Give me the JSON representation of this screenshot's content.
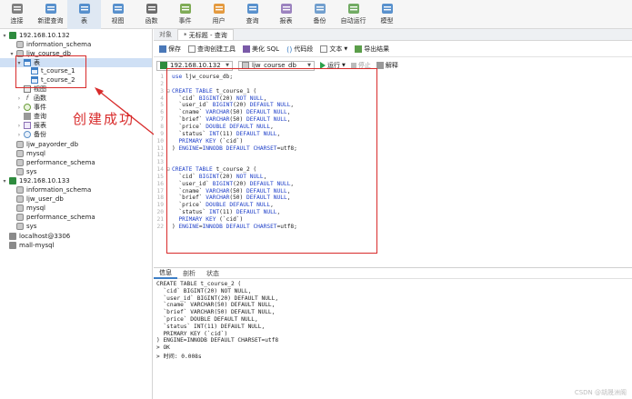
{
  "toolbar": {
    "items": [
      {
        "label": "连接",
        "icon": "connect-icon"
      },
      {
        "label": "新建查询",
        "icon": "new-query-icon"
      },
      {
        "label": "表",
        "icon": "table-icon"
      },
      {
        "label": "视图",
        "icon": "view-icon"
      },
      {
        "label": "函数",
        "icon": "function-icon"
      },
      {
        "label": "事件",
        "icon": "event-icon"
      },
      {
        "label": "用户",
        "icon": "user-icon"
      },
      {
        "label": "查询",
        "icon": "query-icon"
      },
      {
        "label": "报表",
        "icon": "report-icon"
      },
      {
        "label": "备份",
        "icon": "backup-icon"
      },
      {
        "label": "自动运行",
        "icon": "automation-icon"
      },
      {
        "label": "模型",
        "icon": "model-icon"
      }
    ],
    "active_index": 2
  },
  "sidebar": {
    "rows": [
      {
        "text": "192.168.10.132",
        "icon": "conn",
        "expander": "▾"
      },
      {
        "text": "information_schema",
        "icon": "db",
        "expander": ""
      },
      {
        "text": "ljw_course_db",
        "icon": "db",
        "expander": "▾"
      },
      {
        "text": "表",
        "icon": "table",
        "expander": "▾",
        "selected": true
      },
      {
        "text": "t_course_1",
        "icon": "table",
        "expander": ""
      },
      {
        "text": "t_course_2",
        "icon": "table",
        "expander": ""
      },
      {
        "text": "视图",
        "icon": "view",
        "expander": ""
      },
      {
        "text": "函数",
        "icon": "func",
        "expander": "›"
      },
      {
        "text": "事件",
        "icon": "event",
        "expander": "›"
      },
      {
        "text": "查询",
        "icon": "query",
        "expander": ""
      },
      {
        "text": "报表",
        "icon": "report",
        "expander": "›"
      },
      {
        "text": "备份",
        "icon": "backup",
        "expander": "›"
      },
      {
        "text": "ljw_payorder_db",
        "icon": "db",
        "expander": ""
      },
      {
        "text": "mysql",
        "icon": "db",
        "expander": ""
      },
      {
        "text": "performance_schema",
        "icon": "db",
        "expander": ""
      },
      {
        "text": "sys",
        "icon": "db",
        "expander": ""
      },
      {
        "text": "192.168.10.133",
        "icon": "conn",
        "expander": "▾"
      },
      {
        "text": "information_schema",
        "icon": "db",
        "expander": ""
      },
      {
        "text": "ljw_user_db",
        "icon": "db",
        "expander": ""
      },
      {
        "text": "mysql",
        "icon": "db",
        "expander": ""
      },
      {
        "text": "performance_schema",
        "icon": "db",
        "expander": ""
      },
      {
        "text": "sys",
        "icon": "db",
        "expander": ""
      },
      {
        "text": "localhost@3306",
        "icon": "conn-gray",
        "expander": ""
      },
      {
        "text": "mall-mysql",
        "icon": "conn-gray",
        "expander": ""
      }
    ]
  },
  "annotation": {
    "text": "创建成功"
  },
  "tabs": [
    {
      "label": "对象",
      "active": false
    },
    {
      "label": "* 无标题 - 查询",
      "active": true
    }
  ],
  "editor_toolbar": {
    "save": "保存",
    "query_builder": "查询创建工具",
    "beautify": "美化 SQL",
    "snippet": "代码段",
    "text": "文本",
    "export": "导出结果"
  },
  "selectors": {
    "connection": "192.168.10.132",
    "database": "ljw_course_db",
    "run": "运行",
    "stop": "停止",
    "explain": "解释"
  },
  "code_lines": [
    {
      "n": "1",
      "fold": "",
      "text": "use ljw_course_db;"
    },
    {
      "n": "2",
      "fold": "",
      "text": ""
    },
    {
      "n": "3",
      "fold": "⊟",
      "text": "CREATE TABLE t_course_1 ("
    },
    {
      "n": "4",
      "fold": "",
      "text": "  `cid` BIGINT(20) NOT NULL,"
    },
    {
      "n": "5",
      "fold": "",
      "text": "  `user_id` BIGINT(20) DEFAULT NULL,"
    },
    {
      "n": "6",
      "fold": "",
      "text": "  `cname` VARCHAR(50) DEFAULT NULL,"
    },
    {
      "n": "7",
      "fold": "",
      "text": "  `brief` VARCHAR(50) DEFAULT NULL,"
    },
    {
      "n": "8",
      "fold": "",
      "text": "  `price` DOUBLE DEFAULT NULL,"
    },
    {
      "n": "9",
      "fold": "",
      "text": "  `status` INT(11) DEFAULT NULL,"
    },
    {
      "n": "10",
      "fold": "",
      "text": "  PRIMARY KEY (`cid`)"
    },
    {
      "n": "11",
      "fold": "",
      "text": ") ENGINE=INNODB DEFAULT CHARSET=utf8;"
    },
    {
      "n": "12",
      "fold": "",
      "text": ""
    },
    {
      "n": "13",
      "fold": "",
      "text": ""
    },
    {
      "n": "14",
      "fold": "⊟",
      "text": "CREATE TABLE t_course_2 ("
    },
    {
      "n": "15",
      "fold": "",
      "text": "  `cid` BIGINT(20) NOT NULL,"
    },
    {
      "n": "16",
      "fold": "",
      "text": "  `user_id` BIGINT(20) DEFAULT NULL,"
    },
    {
      "n": "17",
      "fold": "",
      "text": "  `cname` VARCHAR(50) DEFAULT NULL,"
    },
    {
      "n": "18",
      "fold": "",
      "text": "  `brief` VARCHAR(50) DEFAULT NULL,"
    },
    {
      "n": "19",
      "fold": "",
      "text": "  `price` DOUBLE DEFAULT NULL,"
    },
    {
      "n": "20",
      "fold": "",
      "text": "  `status` INT(11) DEFAULT NULL,"
    },
    {
      "n": "21",
      "fold": "",
      "text": "  PRIMARY KEY (`cid`)"
    },
    {
      "n": "22",
      "fold": "",
      "text": ") ENGINE=INNODB DEFAULT CHARSET=utf8;"
    }
  ],
  "bottom": {
    "tabs": [
      "信息",
      "剖析",
      "状态"
    ],
    "active_tab": 0,
    "log": [
      "CREATE TABLE t_course_2 (",
      "  `cid` BIGINT(20) NOT NULL,",
      "  `user_id` BIGINT(20) DEFAULT NULL,",
      "  `cname` VARCHAR(50) DEFAULT NULL,",
      "  `brief` VARCHAR(50) DEFAULT NULL,",
      "  `price` DOUBLE DEFAULT NULL,",
      "  `status` INT(11) DEFAULT NULL,",
      "  PRIMARY KEY (`cid`)",
      ") ENGINE=INNODB DEFAULT CHARSET=utf8",
      "> OK",
      "> 时间: 0.008s"
    ]
  },
  "watermark": "CSDN @胡晟洲阁"
}
